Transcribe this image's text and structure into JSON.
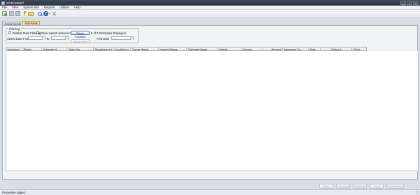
{
  "window": {
    "title": "SCRAMMIT",
    "controls": [
      "_",
      "▫",
      "x"
    ]
  },
  "menu": [
    "File",
    "View",
    "System Info",
    "Reports",
    "Utilities",
    "Help"
  ],
  "toolbar_icons": [
    "new-document-icon",
    "open-folder-icon",
    "print-icon",
    "lightning-icon",
    "mail-icon",
    "search-icon",
    "help-icon",
    "tools-icon"
  ],
  "tabs": [
    {
      "label": "Assignments",
      "active": false
    },
    {
      "label": "Estimates",
      "active": true
    }
  ],
  "filter": {
    "legend": "Filtering",
    "disable_date_filtering_label": "Disable Date Filtering",
    "disable_date_filtering_checked": false,
    "show_latest_versions_label": "Show Latest Versions Only",
    "show_latest_versions_checked": true,
    "reset_columns_label": "Reset Columns",
    "count_text": "0 of 0 Estimates Displayed",
    "saved_date_from_label": "Saved Date From",
    "to_label": "To",
    "date_from_value": "/ /",
    "date_to_value": "/ /",
    "apply_filter_label": "Apply Filter",
    "find_date_label": "Find Date",
    "find_date_value": "/ /"
  },
  "grid": {
    "columns": [
      "Uploaded",
      "Status",
      "Estimate Id",
      "Claim No.",
      "Supplement #",
      "Condition #",
      "Owner Name",
      "Insured Name",
      "Claimant Name",
      "Vehicle",
      "License",
      "Amount",
      "Insurance Co.",
      "Date",
      "",
      "Policy #",
      "File #"
    ],
    "rows": []
  },
  "actions": [
    "Open",
    "Unmerge",
    "Duplicate",
    "Print",
    "Print Preview"
  ],
  "status": {
    "text": "Procedure pages"
  },
  "colors": {
    "titlebar": "#2b3442",
    "active_tab": "#f7e3a0",
    "panel": "#f2f3f5"
  }
}
